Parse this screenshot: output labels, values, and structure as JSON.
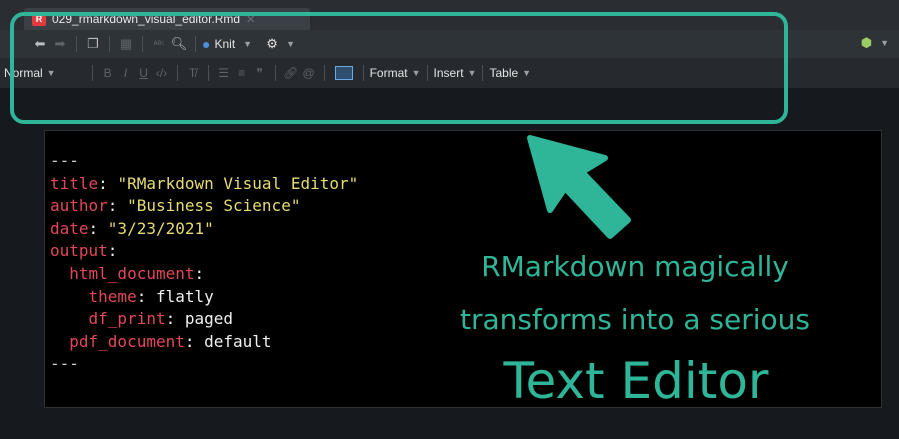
{
  "tab": {
    "filename": "029_rmarkdown_visual_editor.Rmd"
  },
  "toolbar": {
    "knit_label": "Knit"
  },
  "format_bar": {
    "style_select": "Normal",
    "format_menu": "Format",
    "insert_menu": "Insert",
    "table_menu": "Table"
  },
  "yaml": {
    "dashes_open": "---",
    "title_key": "title",
    "title_value": "\"RMarkdown Visual Editor\"",
    "author_key": "author",
    "author_value": "\"Business Science\"",
    "date_key": "date",
    "date_value": "\"3/23/2021\"",
    "output_key": "output",
    "html_key": "html_document",
    "theme_key": "theme",
    "theme_value": "flatly",
    "dfprint_key": "df_print",
    "dfprint_value": "paged",
    "pdf_key": "pdf_document",
    "pdf_value": "default",
    "dashes_close": "---"
  },
  "annotation": {
    "line1": "RMarkdown magically",
    "line2": "transforms into a serious",
    "line3": "Text Editor"
  },
  "colors": {
    "accent": "#2fb597",
    "yaml_key": "#e2485a",
    "yaml_string": "#e6db74"
  }
}
